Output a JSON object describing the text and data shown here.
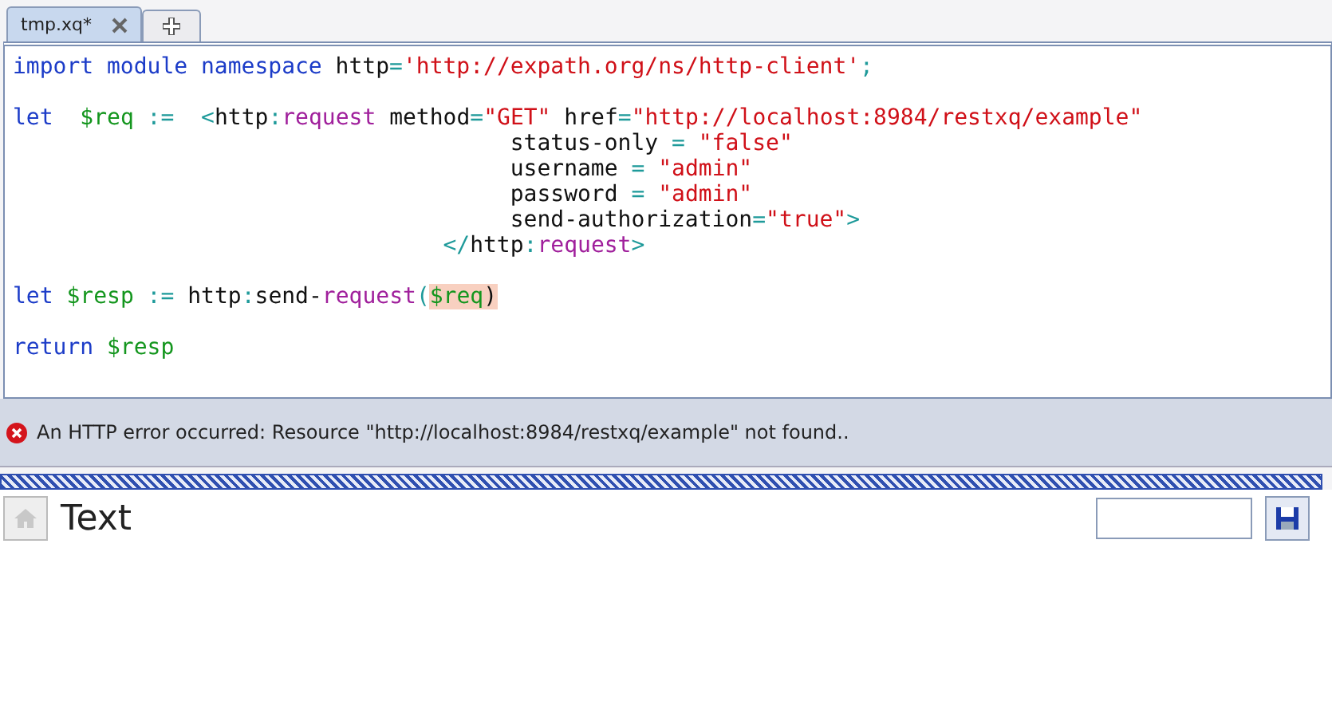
{
  "tabs": [
    {
      "kind": "file",
      "label": "tmp.xq*",
      "selected": true
    },
    {
      "kind": "add",
      "selected": false
    }
  ],
  "editor": {
    "lines": [
      {
        "tokens": [
          {
            "kind": "keyword",
            "text": "import module namespace"
          },
          {
            "kind": "plain",
            "text": " http"
          },
          {
            "kind": "operator",
            "text": "="
          },
          {
            "kind": "string",
            "text": "'http://expath.org/ns/http-client'"
          },
          {
            "kind": "operator",
            "text": ";"
          }
        ]
      },
      {
        "kind": "blank"
      },
      {
        "tokens": [
          {
            "kind": "keyword",
            "text": "let"
          },
          {
            "kind": "variable",
            "text": "  $req"
          },
          {
            "kind": "operator",
            "text": " :="
          },
          {
            "kind": "operator",
            "text": "  <"
          },
          {
            "kind": "plain",
            "text": "http"
          },
          {
            "kind": "operator",
            "text": ":"
          },
          {
            "kind": "element",
            "text": "request"
          },
          {
            "kind": "plain",
            "text": " method"
          },
          {
            "kind": "operator",
            "text": "="
          },
          {
            "kind": "string",
            "text": "\"GET\""
          },
          {
            "kind": "plain",
            "text": " href"
          },
          {
            "kind": "operator",
            "text": "="
          },
          {
            "kind": "string",
            "text": "\"http://localhost:8984/restxq/example\""
          }
        ]
      },
      {
        "tokens": [
          {
            "kind": "plain",
            "text": "                                     status-only "
          },
          {
            "kind": "operator",
            "text": "="
          },
          {
            "kind": "string",
            "text": " \"false\""
          }
        ]
      },
      {
        "tokens": [
          {
            "kind": "plain",
            "text": "                                     username "
          },
          {
            "kind": "operator",
            "text": "="
          },
          {
            "kind": "string",
            "text": " \"admin\""
          }
        ]
      },
      {
        "tokens": [
          {
            "kind": "plain",
            "text": "                                     password "
          },
          {
            "kind": "operator",
            "text": "="
          },
          {
            "kind": "string",
            "text": " \"admin\""
          }
        ]
      },
      {
        "tokens": [
          {
            "kind": "plain",
            "text": "                                     send-authorization"
          },
          {
            "kind": "operator",
            "text": "="
          },
          {
            "kind": "string",
            "text": "\"true\""
          },
          {
            "kind": "operator",
            "text": ">"
          }
        ]
      },
      {
        "tokens": [
          {
            "kind": "operator",
            "text": "                                </"
          },
          {
            "kind": "plain",
            "text": "http"
          },
          {
            "kind": "operator",
            "text": ":"
          },
          {
            "kind": "element",
            "text": "request"
          },
          {
            "kind": "operator",
            "text": ">"
          }
        ]
      },
      {
        "kind": "blank"
      },
      {
        "tokens": [
          {
            "kind": "keyword",
            "text": "let"
          },
          {
            "kind": "variable",
            "text": " $resp"
          },
          {
            "kind": "operator",
            "text": " :="
          },
          {
            "kind": "plain",
            "text": " http"
          },
          {
            "kind": "operator",
            "text": ":"
          },
          {
            "kind": "plain",
            "text": "send-"
          },
          {
            "kind": "element",
            "text": "request"
          },
          {
            "kind": "operator",
            "text": "("
          },
          {
            "kind": "highlight",
            "text": "$req"
          },
          {
            "kind": "highlight-plain",
            "text": ")"
          }
        ]
      },
      {
        "kind": "blank"
      },
      {
        "tokens": [
          {
            "kind": "keyword",
            "text": "return"
          },
          {
            "kind": "variable",
            "text": " $resp"
          }
        ]
      }
    ]
  },
  "status": {
    "kind": "error",
    "message": "An HTTP error occurred: Resource \"http://localhost:8984/restxq/example\" not found.."
  },
  "result_panel": {
    "title": "Text"
  }
}
